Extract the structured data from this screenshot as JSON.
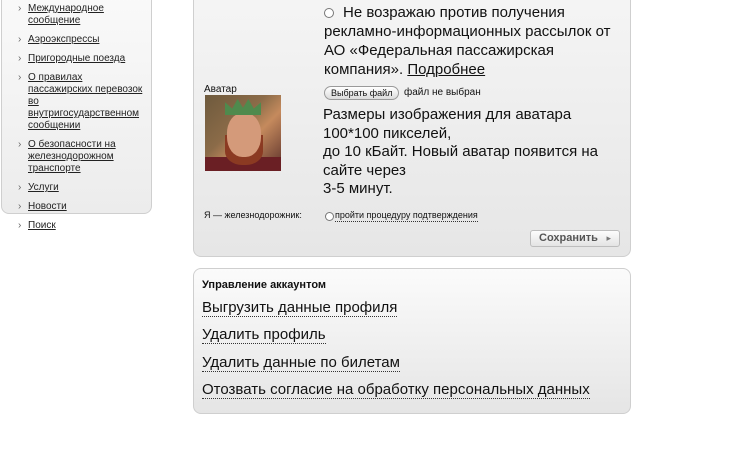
{
  "sidebar": {
    "items": [
      {
        "label": "Международное сообщение"
      },
      {
        "label": "Аэроэкспрессы"
      },
      {
        "label": "Пригородные поезда"
      },
      {
        "label": "О правилах пассажирских перевозок во внутригосударственном сообщении"
      },
      {
        "label": "О безопасности на железнодорожном транспорте"
      },
      {
        "label": "Услуги"
      },
      {
        "label": "Новости"
      },
      {
        "label": "Поиск"
      }
    ],
    "chevron": "›"
  },
  "profile": {
    "consent": {
      "line1": "Не возражаю против получения",
      "rest": "рекламно-информационных рассылок от АО «Федеральная пассажирская компания».",
      "more_link": "Подробнее"
    },
    "avatar_label": "Аватар",
    "file_button": "Выбрать файл",
    "file_status": "файл не выбран",
    "size_note": {
      "l1": "Размеры изображения для аватара",
      "l2": "100*100 пикселей,",
      "l3": "до 10 кБайт. Новый аватар появится на",
      "l4": "сайте через",
      "l5": "3-5 минут."
    },
    "railway_label": "Я — железнодорожник:",
    "railway_link": "пройти процедуру подтверждения",
    "save_button": "Сохранить",
    "save_arrow": "▸"
  },
  "account": {
    "title": "Управление аккаунтом",
    "links": [
      "Выгрузить данные профиля",
      "Удалить профиль",
      "Удалить данные по билетам",
      "Отозвать согласие на обработку персональных данных"
    ]
  }
}
